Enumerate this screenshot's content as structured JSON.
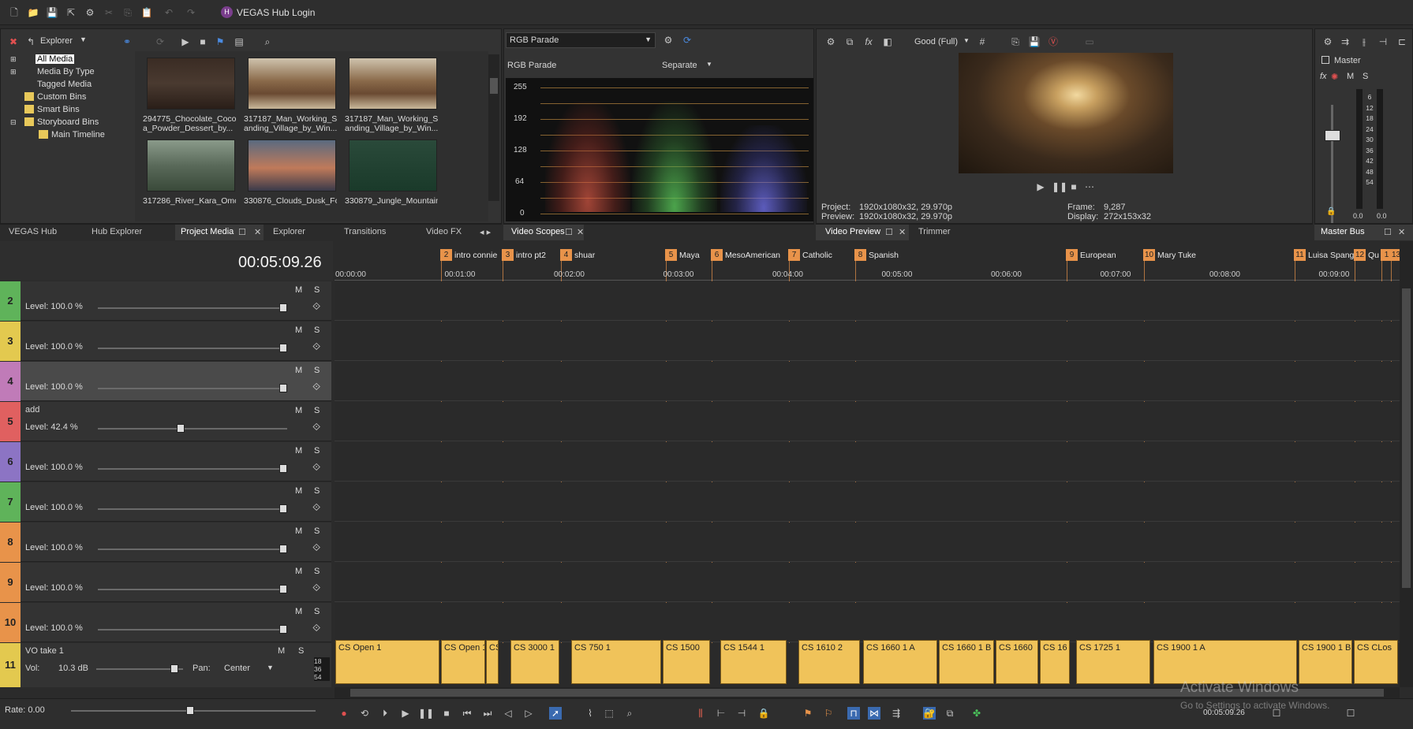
{
  "app": {
    "title": "VEGAS Hub Login",
    "hub_icon": "H"
  },
  "explorer": {
    "dropdown": "Explorer",
    "tree": [
      {
        "label": "All Media"
      },
      {
        "label": "Media By Type"
      },
      {
        "label": "Tagged Media"
      },
      {
        "label": "Custom Bins"
      },
      {
        "label": "Smart Bins"
      },
      {
        "label": "Storyboard Bins"
      },
      {
        "label": "Main Timeline"
      }
    ],
    "media": [
      {
        "line1": "294775_Chocolate_Coco",
        "line2": "a_Powder_Dessert_by..."
      },
      {
        "line1": "317187_Man_Working_S",
        "line2": "anding_Village_by_Win..."
      },
      {
        "line1": "317187_Man_Working_S",
        "line2": "anding_Village_by_Win..."
      },
      {
        "line1": "317286_River_Kara_Omo",
        "line2": ""
      },
      {
        "line1": "330876_Clouds_Dusk_For",
        "line2": ""
      },
      {
        "line1": "330879_Jungle_Mountain",
        "line2": ""
      }
    ]
  },
  "scopes": {
    "dropdown": "RGB Parade",
    "label": "RGB Parade",
    "mode": "Separate",
    "y_ticks": [
      "255",
      "192",
      "128",
      "64",
      "0"
    ]
  },
  "preview": {
    "quality": "Good (Full)",
    "project_label": "Project:",
    "project_value": "1920x1080x32, 29.970p",
    "preview_label": "Preview:",
    "preview_value": "1920x1080x32, 29.970p",
    "frame_label": "Frame:",
    "frame_value": "9,287",
    "display_label": "Display:",
    "display_value": "272x153x32"
  },
  "master": {
    "label": "Master",
    "m": "M",
    "s": "S",
    "meter_ticks": [
      "6",
      "12",
      "18",
      "24",
      "30",
      "36",
      "42",
      "48",
      "54"
    ],
    "left_val": "0.0",
    "right_val": "0.0"
  },
  "tabs_left": [
    "VEGAS Hub",
    "Hub Explorer",
    "Project Media",
    "Explorer",
    "Transitions",
    "Video FX"
  ],
  "tabs_scopes": [
    "Video Scopes"
  ],
  "tabs_preview": [
    "Video Preview",
    "Trimmer"
  ],
  "tabs_master": [
    "Master Bus"
  ],
  "timeline": {
    "timecode": "00:05:09.26",
    "ruler": [
      "00:00:00",
      "00:01:00",
      "00:02:00",
      "00:03:00",
      "00:04:00",
      "00:05:00",
      "00:06:00",
      "00:07:00",
      "00:08:00",
      "00:09:00"
    ],
    "markers": [
      {
        "num": "2",
        "name": "intro connie"
      },
      {
        "num": "3",
        "name": "intro pt2"
      },
      {
        "num": "4",
        "name": "shuar"
      },
      {
        "num": "5",
        "name": "Maya"
      },
      {
        "num": "6",
        "name": "MesoAmerican"
      },
      {
        "num": "7",
        "name": "Catholic"
      },
      {
        "num": "8",
        "name": "Spanish"
      },
      {
        "num": "9",
        "name": "European"
      },
      {
        "num": "10",
        "name": "Mary Tuke"
      },
      {
        "num": "11",
        "name": "Luisa Spangol"
      },
      {
        "num": "12",
        "name": "Qu"
      },
      {
        "num": "1",
        "name": ""
      },
      {
        "num": "13",
        "name": ""
      }
    ],
    "tracks": [
      {
        "num": "2",
        "name": "",
        "level": "Level: 100.0 %",
        "m": "M",
        "s": "S",
        "color": "#5fb35a"
      },
      {
        "num": "3",
        "name": "",
        "level": "Level: 100.0 %",
        "m": "M",
        "s": "S",
        "color": "#e3c94f"
      },
      {
        "num": "4",
        "name": "",
        "level": "Level: 100.0 %",
        "m": "M",
        "s": "S",
        "color": "#c07bb8"
      },
      {
        "num": "5",
        "name": "add",
        "level": "Level:   42.4 %",
        "m": "M",
        "s": "S",
        "color": "#e06060"
      },
      {
        "num": "6",
        "name": "",
        "level": "Level: 100.0 %",
        "m": "M",
        "s": "S",
        "color": "#8c74c4"
      },
      {
        "num": "7",
        "name": "",
        "level": "Level: 100.0 %",
        "m": "M",
        "s": "S",
        "color": "#5fb35a"
      },
      {
        "num": "8",
        "name": "",
        "level": "Level: 100.0 %",
        "m": "M",
        "s": "S",
        "color": "#e8934a"
      },
      {
        "num": "9",
        "name": "",
        "level": "Level: 100.0 %",
        "m": "M",
        "s": "S",
        "color": "#e8934a"
      },
      {
        "num": "10",
        "name": "",
        "level": "Level: 100.0 %",
        "m": "M",
        "s": "S",
        "color": "#e8934a"
      }
    ],
    "audio_track": {
      "num": "11",
      "name": "VO take 1",
      "vol_label": "Vol:",
      "vol_value": "10.3 dB",
      "pan_label": "Pan:",
      "pan_value": "Center",
      "m": "M",
      "s": "S",
      "meter": [
        "18",
        "36",
        "54"
      ]
    },
    "audio_clips": [
      "CS Open 1",
      "CS Open 1",
      "CS",
      "CS 3000 1",
      "CS 750 1",
      "CS 1500",
      "CS 1544 1",
      "CS 1610 2",
      "CS 1660 1 A",
      "CS 1660 1 B",
      "CS 1660",
      "CS 16",
      "CS 1725 1",
      "CS 1900 1 A",
      "CS 1900 1 B",
      "CS CLos"
    ],
    "rate": "Rate: 0.00",
    "bottom_timecode": "00:05:09.26"
  },
  "watermark": {
    "line1": "Activate Windows",
    "line2": "Go to Settings to activate Windows."
  },
  "colors": {
    "accent": "#e8934a",
    "bg": "#2b2b2b",
    "panel": "#333333",
    "audio_clip": "#f0c35a"
  }
}
